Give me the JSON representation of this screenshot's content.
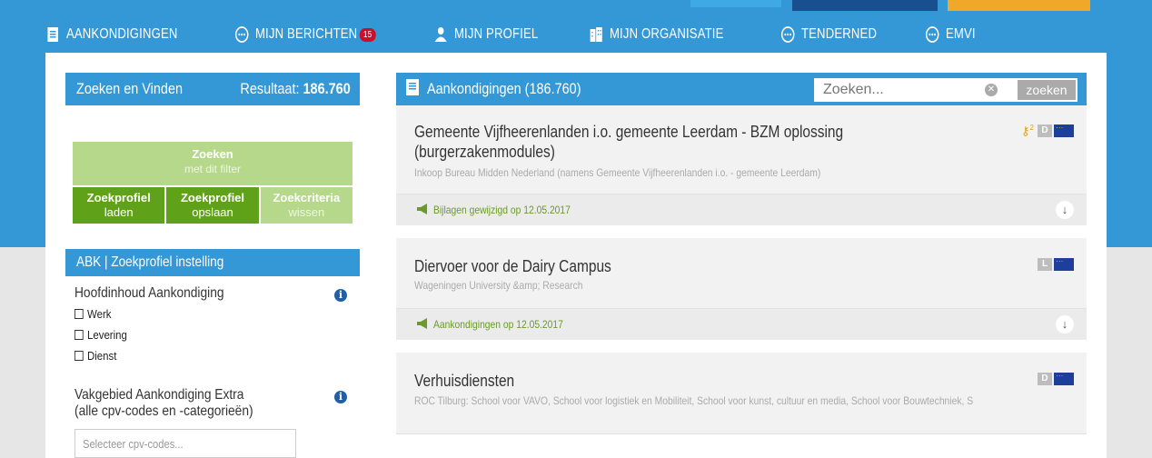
{
  "nav": {
    "items": [
      {
        "label": "AANKONDIGINGEN",
        "icon": "document-icon"
      },
      {
        "label": "MIJN BERICHTEN",
        "icon": "dots-circle-icon",
        "badge": "15"
      },
      {
        "label": "MIJN PROFIEL",
        "icon": "user-icon"
      },
      {
        "label": "MIJN ORGANISATIE",
        "icon": "building-icon"
      },
      {
        "label": "TENDERNED",
        "icon": "dots-circle-icon"
      },
      {
        "label": "EMVI",
        "icon": "dots-circle-icon"
      }
    ]
  },
  "left": {
    "title": "Zoeken en Vinden",
    "result_label": "Resultaat:",
    "result_value": "186.760",
    "search_btn": {
      "main": "Zoeken",
      "sub": "met dit filter"
    },
    "buttons": [
      {
        "main": "Zoekprofiel",
        "sub": "laden"
      },
      {
        "main": "Zoekprofiel",
        "sub": "opslaan"
      },
      {
        "main": "Zoekcriteria",
        "sub": "wissen"
      }
    ],
    "abk_title": "ABK | Zoekprofiel instelling",
    "filter1": {
      "title": "Hoofdinhoud Aankondiging",
      "options": [
        "Werk",
        "Levering",
        "Dienst"
      ]
    },
    "filter2": {
      "title_line1": "Vakgebied Aankondiging Extra",
      "title_line2": "(alle cpv-codes en -categorieën)",
      "placeholder": "Selecteer cpv-codes..."
    }
  },
  "right": {
    "title": "Aankondigingen (186.760)",
    "search_placeholder": "Zoeken...",
    "search_button": "zoeken",
    "items": [
      {
        "title": "Gemeente Vijfheerenlanden i.o. gemeente Leerdam - BZM oplossing (burgerzakenmodules)",
        "org": "Inkoop Bureau Midden Nederland (namens Gemeente Vijfheerenlanden i.o. - gemeente Leerdam)",
        "tag": "D",
        "key_badge": "2",
        "notice": "Bijlagen gewijzigd op 12.05.2017"
      },
      {
        "title": "Diervoer voor de Dairy Campus",
        "org": "Wageningen University &amp; Research",
        "tag": "L",
        "notice": "Aankondigingen op 12.05.2017"
      },
      {
        "title": "Verhuisdiensten",
        "org": "ROC Tilburg: School voor VAVO, School voor logistiek en Mobiliteit, School voor kunst, cultuur en media, School voor Bouwtechniek, S",
        "tag": "D"
      }
    ]
  },
  "colors": {
    "primary": "#3497d6",
    "green_dark": "#5fa21a",
    "green_light": "#b6d88a",
    "badge": "#c8102e"
  }
}
